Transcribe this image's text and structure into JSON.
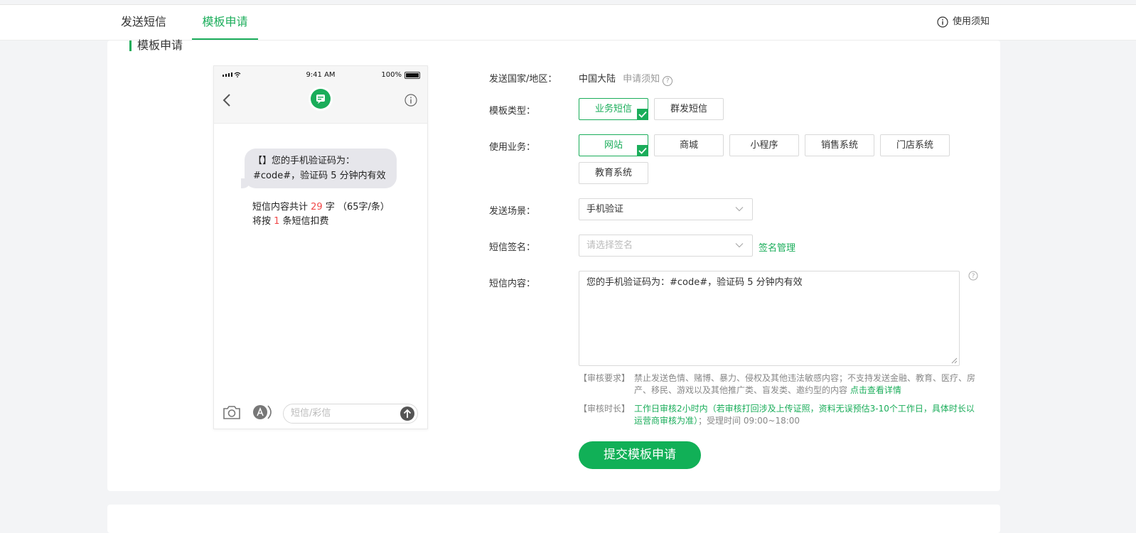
{
  "tabs": [
    {
      "label": "发送短信",
      "active": false
    },
    {
      "label": "模板申请",
      "active": true
    }
  ],
  "notice_label": "使用须知",
  "section_title": "模板申请",
  "phone": {
    "time": "9:41 AM",
    "battery": "100%",
    "bubble": "【】您的手机验证码为：#code#，验证码 5 分钟内有效",
    "count_prefix": "短信内容共计 ",
    "count_chars": "29",
    "count_mid": " 字 （65字/条）将按 ",
    "count_msgs": "1",
    "count_suffix": " 条短信扣费",
    "input_placeholder": "短信/彩信"
  },
  "form": {
    "country_label": "发送国家/地区：",
    "country_value": "中国大陆",
    "country_notice": "申请须知",
    "type_label": "模板类型：",
    "types": [
      "业务短信",
      "群发短信"
    ],
    "business_label": "使用业务：",
    "businesses": [
      "网站",
      "商城",
      "小程序",
      "销售系统",
      "门店系统",
      "教育系统"
    ],
    "scene_label": "发送场景：",
    "scene_value": "手机验证",
    "sign_label": "短信签名：",
    "sign_placeholder": "请选择签名",
    "sign_manage": "签名管理",
    "content_label": "短信内容：",
    "content_value": "您的手机验证码为：#code#，验证码 5 分钟内有效",
    "review_req_tag": "【审核要求】",
    "review_req_text": "禁止发送色情、赌博、暴力、侵权及其他违法敏感内容；不支持发送金融、教育、医疗、房产、移民、游戏以及其他推广类、盲发类、邀约型的内容",
    "review_req_link": "点击查看详情",
    "review_time_tag": "【审核时长】",
    "review_time_green": "工作日审核2小时内（若审核打回涉及上传证照，资料无误预估3-10个工作日，具体时长以运营商审核为准）",
    "review_time_rest": "；受理时间 09:00~18:00",
    "submit_label": "提交模板申请"
  },
  "colors": {
    "accent": "#1aad5a",
    "highlight": "#f04848"
  }
}
